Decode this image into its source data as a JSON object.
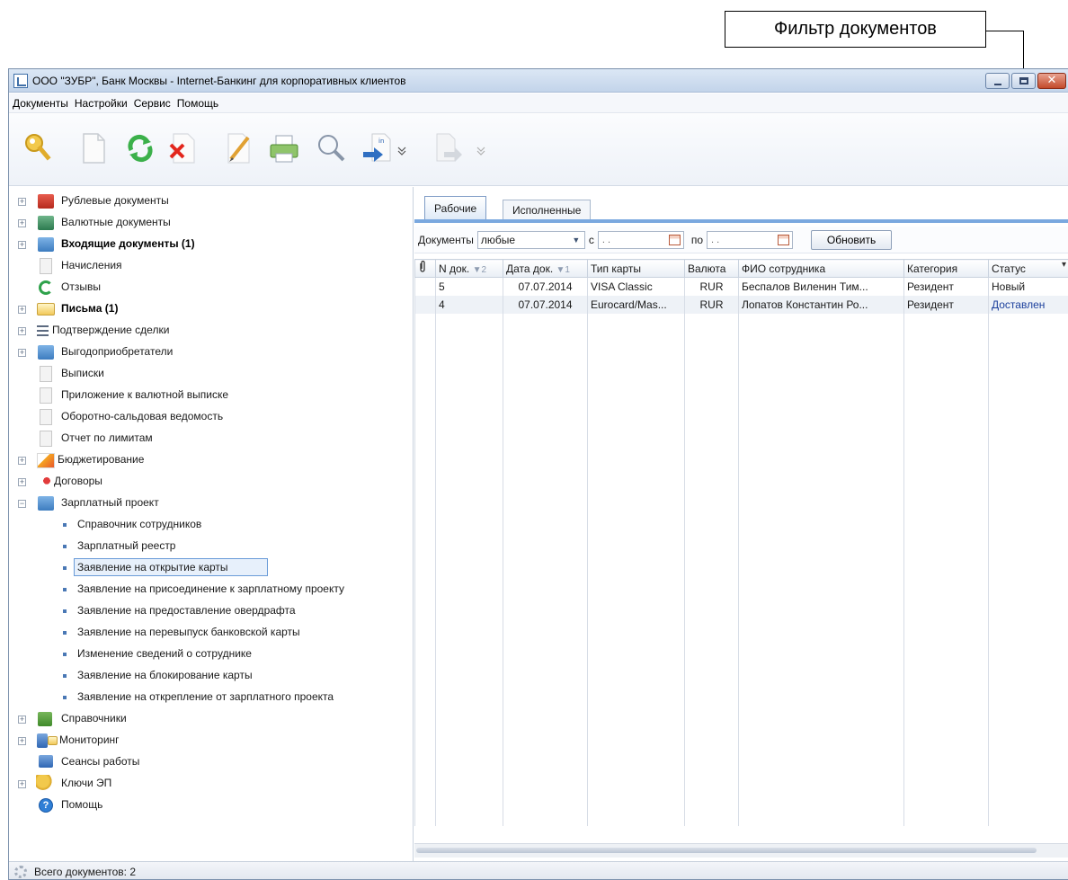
{
  "callout": {
    "label": "Фильтр документов"
  },
  "window": {
    "title": "ООО \"ЗУБР\", Банк Москвы - Internet-Банкинг для корпоративных клиентов"
  },
  "menu": [
    "Документы",
    "Настройки",
    "Сервис",
    "Помощь"
  ],
  "toolbar": {
    "icons": [
      "key-icon",
      "new-document-icon",
      "refresh-icon",
      "delete-icon",
      "edit-icon",
      "print-icon",
      "search-icon",
      "import-icon",
      "more-chevron-icon",
      "export-icon",
      "more-chevron-icon"
    ]
  },
  "tree": {
    "items": [
      {
        "label": "Рублевые документы",
        "bold": false,
        "icon": "rub-folder-icon"
      },
      {
        "label": "Валютные документы",
        "bold": false,
        "icon": "currency-folder-icon"
      },
      {
        "label": "Входящие документы (1)",
        "bold": true,
        "icon": "incoming-folder-icon"
      },
      {
        "label": "Начисления",
        "bold": false,
        "icon": "document-icon"
      },
      {
        "label": "Отзывы",
        "bold": false,
        "icon": "recall-icon"
      },
      {
        "label": "Письма (1)",
        "bold": true,
        "icon": "letter-icon"
      },
      {
        "label": "Подтверждение сделки",
        "bold": false,
        "icon": "list-icon"
      },
      {
        "label": "Выгодоприобретатели",
        "bold": false,
        "icon": "folder-icon"
      },
      {
        "label": "Выписки",
        "bold": false,
        "icon": "document-icon"
      },
      {
        "label": "Приложение к валютной выписке",
        "bold": false,
        "icon": "document-icon"
      },
      {
        "label": "Оборотно-сальдовая ведомость",
        "bold": false,
        "icon": "document-icon"
      },
      {
        "label": "Отчет по лимитам",
        "bold": false,
        "icon": "document-icon"
      },
      {
        "label": "Бюджетирование",
        "bold": false,
        "icon": "chart-icon"
      },
      {
        "label": "Договоры",
        "bold": false,
        "icon": "ribbon-icon"
      },
      {
        "label": "Зарплатный проект",
        "bold": false,
        "icon": "folder-icon"
      },
      {
        "label": "Справочник сотрудников",
        "bold": false,
        "icon": "bullet"
      },
      {
        "label": "Зарплатный реестр",
        "bold": false,
        "icon": "bullet"
      },
      {
        "label": "Заявление на открытие карты",
        "bold": false,
        "icon": "bullet"
      },
      {
        "label": "Заявление на присоединение к зарплатному проекту",
        "bold": false,
        "icon": "bullet"
      },
      {
        "label": "Заявление на предоставление овердрафта",
        "bold": false,
        "icon": "bullet"
      },
      {
        "label": "Заявление на перевыпуск банковской карты",
        "bold": false,
        "icon": "bullet"
      },
      {
        "label": "Изменение сведений о сотруднике",
        "bold": false,
        "icon": "bullet"
      },
      {
        "label": "Заявление на блокирование карты",
        "bold": false,
        "icon": "bullet"
      },
      {
        "label": "Заявление на открепление от зарплатного проекта",
        "bold": false,
        "icon": "bullet"
      },
      {
        "label": "Справочники",
        "bold": false,
        "icon": "book-icon"
      },
      {
        "label": "Мониторинг",
        "bold": false,
        "icon": "monitoring-icon"
      },
      {
        "label": "Сеансы работы",
        "bold": false,
        "icon": "monitor-icon"
      },
      {
        "label": "Ключи ЭП",
        "bold": false,
        "icon": "key-icon"
      },
      {
        "label": "Помощь",
        "bold": false,
        "icon": "help-icon"
      }
    ],
    "selected": "Заявление на открытие карты"
  },
  "tabs": [
    "Рабочие",
    "Исполненные"
  ],
  "filter": {
    "documents_label": "Документы",
    "documents_value": "любые",
    "from_label": "с",
    "from_value": " .  .",
    "to_label": "по",
    "to_value": " .  .",
    "refresh_button": "Обновить"
  },
  "table": {
    "columns": [
      {
        "label": "",
        "icon": "attachment-icon"
      },
      {
        "label": "N док.",
        "sort": "▼2"
      },
      {
        "label": "Дата док.",
        "sort": "▼1"
      },
      {
        "label": "Тип карты"
      },
      {
        "label": "Валюта"
      },
      {
        "label": "ФИО сотрудника"
      },
      {
        "label": "Категория"
      },
      {
        "label": "Статус",
        "menu": "▾"
      }
    ],
    "rows": [
      [
        "",
        "5",
        "07.07.2014",
        "VISA Classic",
        "RUR",
        "Беспалов Виленин Тим...",
        "Резидент",
        "Новый"
      ],
      [
        "",
        "4",
        "07.07.2014",
        "Eurocard/Mas...",
        "RUR",
        "Лопатов Константин Ро...",
        "Резидент",
        "Доставлен"
      ]
    ]
  },
  "status": {
    "text": "Всего документов: 2"
  },
  "colors": {
    "accent": "#7aa8df",
    "status_delivered": "#1b3f9c",
    "selection": "#e7f0fb"
  }
}
